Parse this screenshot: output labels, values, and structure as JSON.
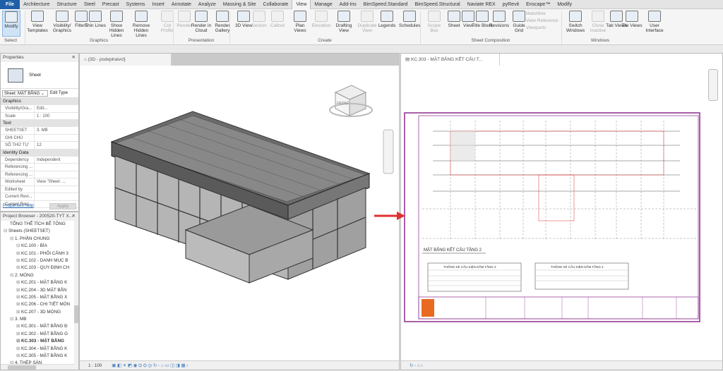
{
  "tabs": [
    "File",
    "Architecture",
    "Structure",
    "Steel",
    "Precast",
    "Systems",
    "Insert",
    "Annotate",
    "Analyze",
    "Massing & Site",
    "Collaborate",
    "View",
    "Manage",
    "Add-Ins",
    "BimSpeed.Standard",
    "BimSpeed.Structural",
    "Naviate REX",
    "pyRevit",
    "Enscape™",
    "Modify"
  ],
  "active_tab": "View",
  "ribbon": {
    "buttons": [
      "Modify",
      "View Templates",
      "Visibility/ Graphics",
      "Filters",
      "Thin Lines",
      "Show Hidden Lines",
      "Remove Hidden Lines",
      "Cut Profile",
      "Render",
      "Render in Cloud",
      "Render Gallery",
      "3D View",
      "Section",
      "Callout",
      "Plan Views",
      "Elevation",
      "Drafting View",
      "Duplicate View",
      "Legends",
      "Schedules",
      "Scope Box",
      "Sheet",
      "View",
      "Title Block",
      "Revisions",
      "Guide Grid",
      "Switch Windows",
      "Close Inactive",
      "Tab Views",
      "Tile Views",
      "User Interface"
    ],
    "small": [
      "Matchline",
      "View Reference",
      "Viewports"
    ],
    "panels": [
      "Select",
      "Graphics",
      "Presentation",
      "Create",
      "Sheet Composition",
      "Windows"
    ]
  },
  "properties": {
    "title": "Properties",
    "type": "Sheet",
    "selector": "Sheet: MẶT BẰNG",
    "edit_type": "Edit Type",
    "groups": [
      {
        "name": "Graphics",
        "rows": [
          [
            "Visibility/Gra...",
            "Edit..."
          ],
          [
            "Scale",
            "1 : 100"
          ]
        ]
      },
      {
        "name": "Text",
        "rows": [
          [
            "SHEETSET",
            "3. MB"
          ],
          [
            "GHI CHÚ",
            ""
          ],
          [
            "SỐ THỨ TỰ",
            "12"
          ]
        ]
      },
      {
        "name": "Identity Data",
        "rows": [
          [
            "Dependency",
            "Independent"
          ],
          [
            "Referencing ...",
            ""
          ],
          [
            "Referencing ...",
            ""
          ],
          [
            "Worksheet",
            "View \"Sheet: ..."
          ],
          [
            "Edited by",
            ""
          ],
          [
            "Current Revi...",
            ""
          ],
          [
            "Current Revi...",
            ""
          ]
        ]
      }
    ],
    "help": "Properties help",
    "apply": "Apply"
  },
  "browser": {
    "title": "Project Browser - 200520-TYT X...",
    "items": [
      "TỔNG THỂ TÍCH BÊ TÔNG",
      "Sheets (SHEETSET)",
      "1. PHẦN CHUNG",
      "KC.100 - BÌA",
      "KC.101 - PHỐI CẢNH 3",
      "KC.102 - DANH MỤC B",
      "KC.103 - QUY ĐỊNH CH",
      "2. MÓNG",
      "KC.201 - MẶT BẰNG K",
      "KC.204 - 3D MẶT BẰN",
      "KC.205 - MẶT BẰNG X",
      "KC.206 - CHI TIẾT MÓN",
      "KC.207 - 3D MÓNG",
      "3. MB",
      "KC.301 - MẶT BẰNG Đ",
      "KC.302 - MẶT BẰNG G",
      "KC.303 - MẶT BẰNG",
      "KC.304 - MẶT BẰNG K",
      "KC.305 - MẶT BẰNG K",
      "4. THÉP SÀN",
      "KC.400 - MẶT BẰNG B"
    ],
    "indent": [
      1,
      0,
      1,
      2,
      2,
      2,
      2,
      1,
      2,
      2,
      2,
      2,
      2,
      1,
      2,
      2,
      2,
      2,
      2,
      1,
      2
    ],
    "selected": 16
  },
  "view3d": {
    "tab": "{3D - psdeptraivcl}",
    "scale": "1 : 100",
    "cube": "FRONT"
  },
  "sheet": {
    "tab": "KC.303 - MẶT BẰNG KẾT CẤU T...",
    "plan_title": "MẶT BẰNG KẾT CẤU TẦNG 2",
    "table1": "THỐNG KÊ CẤU KIỆN DẦM TẦNG 2",
    "table2": "THỐNG KÊ CẤU KIỆN DẦM TẦNG 2"
  },
  "colors": {
    "accent": "#1f5fa8",
    "sheet_border": "#8b2a8b",
    "arrow": "#e03030"
  }
}
